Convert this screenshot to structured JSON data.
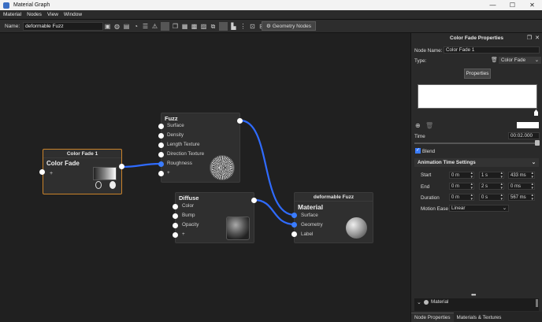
{
  "window": {
    "title": "Material Graph",
    "minimize": "—",
    "maximize": "☐",
    "close": "✕"
  },
  "menu": [
    "Material",
    "Nodes",
    "View",
    "Window"
  ],
  "toolbar": {
    "name_label": "Name:",
    "name_value": "deformable Fuzz",
    "geometry_button": "Geometry Nodes"
  },
  "nodes": {
    "color_fade": {
      "header": "Color Fade 1",
      "title": "Color Fade",
      "add": "+"
    },
    "fuzz": {
      "title": "Fuzz",
      "ports": [
        "Surface",
        "Density",
        "Length Texture",
        "Direction Texture",
        "Roughness",
        "+"
      ]
    },
    "diffuse": {
      "title": "Diffuse",
      "ports": [
        "Color",
        "Bump",
        "Opacity",
        "+"
      ]
    },
    "material": {
      "header": "deformable Fuzz",
      "title": "Material",
      "ports": [
        "Surface",
        "Geometry",
        "Label"
      ]
    }
  },
  "panel": {
    "title": "Color Fade Properties",
    "node_name_label": "Node Name:",
    "node_name_value": "Color Fade 1",
    "type_label": "Type:",
    "type_value": "Color Fade",
    "properties_button": "Properties",
    "time_label": "Time",
    "time_value": "00:02.000",
    "blend_label": "Blend",
    "anim_section": "Animation Time Settings",
    "start_label": "Start",
    "end_label": "End",
    "duration_label": "Duration",
    "motion_ease_label": "Motion Ease",
    "motion_ease_value": "Linear",
    "start": {
      "m": "0 m",
      "s": "1 s",
      "ms": "433 ms"
    },
    "end": {
      "m": "0 m",
      "s": "2 s",
      "ms": "0 ms"
    },
    "duration": {
      "m": "0 m",
      "s": "0 s",
      "ms": "567 ms"
    },
    "more": "•••",
    "tree_item": "Material",
    "tabs": [
      "Node Properties",
      "Materials & Textures"
    ]
  },
  "colors": {
    "wire": "#2f6bff",
    "node_border_selected": "#c9822a"
  }
}
